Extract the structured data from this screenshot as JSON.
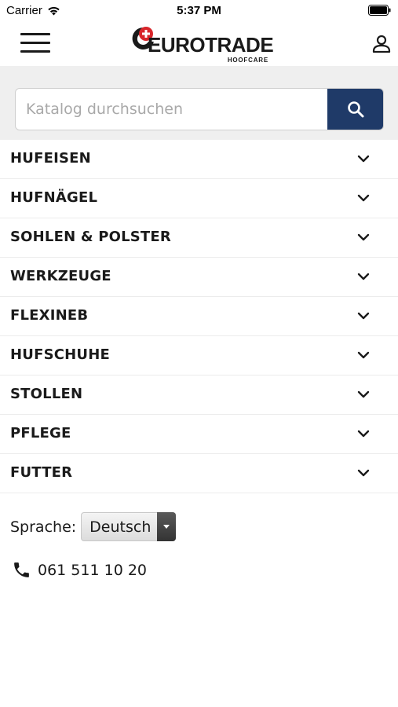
{
  "status_bar": {
    "carrier": "Carrier",
    "time": "5:37 PM",
    "wifi_icon": "wifi-icon",
    "battery_icon": "battery-icon"
  },
  "header": {
    "menu_icon": "hamburger-menu-icon",
    "logo": {
      "name": "EUROTRADE",
      "sub": "HOOFCARE"
    },
    "account_icon": "user-icon"
  },
  "search": {
    "placeholder": "Katalog durchsuchen",
    "value": "",
    "button_icon": "search-icon"
  },
  "categories": [
    {
      "label": "HUFEISEN"
    },
    {
      "label": "HUFNÄGEL"
    },
    {
      "label": "SOHLEN & POLSTER"
    },
    {
      "label": "WERKZEUGE"
    },
    {
      "label": "FLEXINEB"
    },
    {
      "label": "HUFSCHUHE"
    },
    {
      "label": "STOLLEN"
    },
    {
      "label": "PFLEGE"
    },
    {
      "label": "FUTTER"
    }
  ],
  "language": {
    "label": "Sprache:",
    "selected": "Deutsch"
  },
  "contact": {
    "phone_icon": "phone-icon",
    "phone": "061 511 10 20"
  },
  "colors": {
    "accent": "#1f3a68",
    "logo_red": "#d8262b",
    "search_band": "#efefef"
  }
}
